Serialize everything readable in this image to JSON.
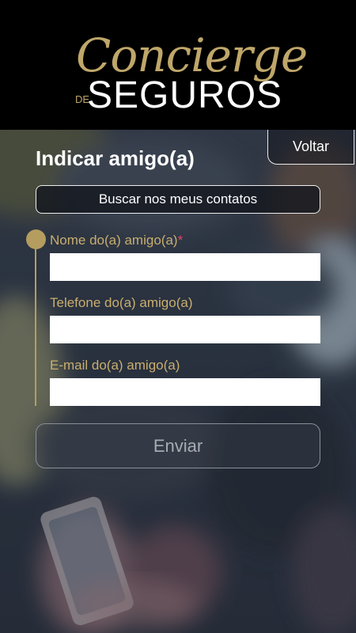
{
  "header": {
    "logo": {
      "script_text": "Concierge",
      "small_text": "DE",
      "main_text": "SEGUROS"
    }
  },
  "nav": {
    "back_label": "Voltar"
  },
  "page": {
    "title": "Indicar amigo(a)"
  },
  "contacts_button": {
    "label": "Buscar nos meus contatos"
  },
  "form": {
    "fields": [
      {
        "label": "Nome do(a) amigo(a)",
        "required_mark": "*",
        "value": "",
        "placeholder": ""
      },
      {
        "label": "Telefone do(a) amigo(a)",
        "value": "",
        "placeholder": ""
      },
      {
        "label": "E-mail do(a) amigo(a)",
        "value": "",
        "placeholder": ""
      }
    ],
    "submit_label": "Enviar"
  },
  "colors": {
    "header_bg": "#000000",
    "gold_accent": "#b59d5f",
    "label_gold": "#c9ae6e",
    "required": "#e0466a",
    "overlay": "#2a3240"
  }
}
